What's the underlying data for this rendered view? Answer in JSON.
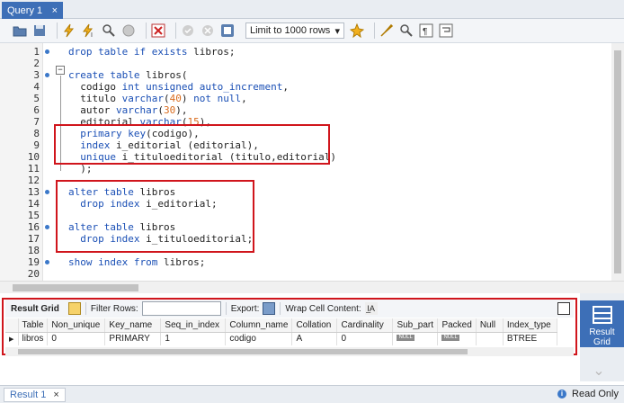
{
  "tab": {
    "label": "Query 1",
    "close": "×"
  },
  "toolbar": {
    "limit": "Limit to 1000 rows",
    "icons": [
      "folder-open-icon",
      "save-icon",
      "execute-icon",
      "execute-current-icon",
      "explain-icon",
      "stop-icon",
      "toggle-autocommit-icon",
      "commit-icon",
      "rollback-icon",
      "toggle-icon",
      "limit-dropdown",
      "beautify-icon",
      "find-icon",
      "invisible-chars-icon",
      "wrap-icon"
    ]
  },
  "editor": {
    "lines": [
      {
        "n": "1",
        "dot": true,
        "tokens": [
          [
            "kw",
            "drop table if exists "
          ],
          [
            "id",
            "libros;"
          ]
        ]
      },
      {
        "n": "2",
        "dot": false,
        "tokens": []
      },
      {
        "n": "3",
        "dot": true,
        "tokens": [
          [
            "kw",
            "create table "
          ],
          [
            "id",
            "libros("
          ]
        ]
      },
      {
        "n": "4",
        "dot": false,
        "tokens": [
          [
            "id",
            "  codigo "
          ],
          [
            "kw",
            "int unsigned auto_increment"
          ],
          [
            "id",
            ","
          ]
        ]
      },
      {
        "n": "5",
        "dot": false,
        "tokens": [
          [
            "id",
            "  titulo "
          ],
          [
            "kw",
            "varchar"
          ],
          [
            "id",
            "("
          ],
          [
            "num",
            "40"
          ],
          [
            "id",
            ") "
          ],
          [
            "kw",
            "not null"
          ],
          [
            "id",
            ","
          ]
        ]
      },
      {
        "n": "6",
        "dot": false,
        "tokens": [
          [
            "id",
            "  autor "
          ],
          [
            "kw",
            "varchar"
          ],
          [
            "id",
            "("
          ],
          [
            "num",
            "30"
          ],
          [
            "id",
            "),"
          ]
        ]
      },
      {
        "n": "7",
        "dot": false,
        "tokens": [
          [
            "id",
            "  editorial "
          ],
          [
            "kw",
            "varchar"
          ],
          [
            "id",
            "("
          ],
          [
            "num",
            "15"
          ],
          [
            "id",
            "),"
          ]
        ]
      },
      {
        "n": "8",
        "dot": false,
        "tokens": [
          [
            "kw",
            "  primary key"
          ],
          [
            "id",
            "(codigo),"
          ]
        ]
      },
      {
        "n": "9",
        "dot": false,
        "tokens": [
          [
            "kw",
            "  index "
          ],
          [
            "id",
            "i_editorial (editorial),"
          ]
        ]
      },
      {
        "n": "10",
        "dot": false,
        "tokens": [
          [
            "kw",
            "  unique "
          ],
          [
            "id",
            "i_tituloeditorial (titulo,editorial)"
          ]
        ]
      },
      {
        "n": "11",
        "dot": false,
        "tokens": [
          [
            "id",
            "  );"
          ]
        ]
      },
      {
        "n": "12",
        "dot": false,
        "tokens": []
      },
      {
        "n": "13",
        "dot": true,
        "tokens": [
          [
            "kw",
            "alter table "
          ],
          [
            "id",
            "libros"
          ]
        ]
      },
      {
        "n": "14",
        "dot": false,
        "tokens": [
          [
            "kw",
            "  drop index "
          ],
          [
            "id",
            "i_editorial;"
          ]
        ]
      },
      {
        "n": "15",
        "dot": false,
        "tokens": []
      },
      {
        "n": "16",
        "dot": true,
        "tokens": [
          [
            "kw",
            "alter table "
          ],
          [
            "id",
            "libros"
          ]
        ]
      },
      {
        "n": "17",
        "dot": false,
        "tokens": [
          [
            "kw",
            "  drop index "
          ],
          [
            "id",
            "i_tituloeditorial;"
          ]
        ]
      },
      {
        "n": "18",
        "dot": false,
        "tokens": []
      },
      {
        "n": "19",
        "dot": true,
        "tokens": [
          [
            "kw",
            "show index from "
          ],
          [
            "id",
            "libros;"
          ]
        ]
      },
      {
        "n": "20",
        "dot": false,
        "tokens": []
      }
    ]
  },
  "results": {
    "result_grid": "Result Grid",
    "filter_rows": "Filter Rows:",
    "export": "Export:",
    "wrap": "Wrap Cell Content:",
    "columns": [
      "Table",
      "Non_unique",
      "Key_name",
      "Seq_in_index",
      "Column_name",
      "Collation",
      "Cardinality",
      "Sub_part",
      "Packed",
      "Null",
      "Index_type"
    ],
    "rows": [
      [
        "libros",
        "0",
        "PRIMARY",
        "1",
        "codigo",
        "A",
        "0",
        "NULL",
        "NULL",
        "",
        "BTREE"
      ]
    ]
  },
  "side": {
    "result_grid": "Result Grid"
  },
  "bottom": {
    "result_tab": "Result 1",
    "close": "×",
    "read_only": "Read Only",
    "info": "i"
  }
}
